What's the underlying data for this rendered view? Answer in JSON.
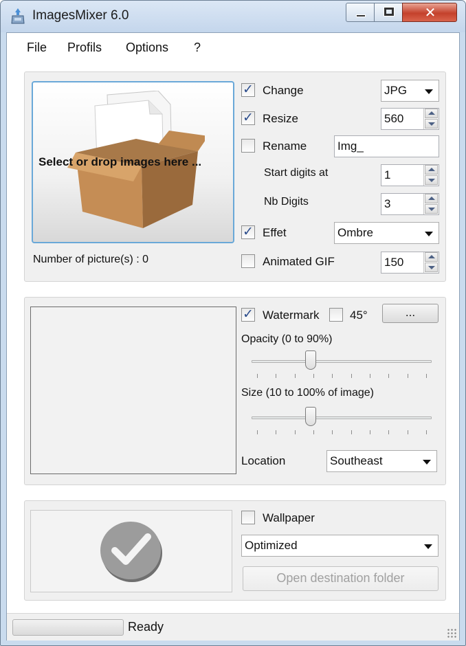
{
  "window": {
    "title": "ImagesMixer 6.0"
  },
  "menu": [
    "File",
    "Profils",
    "Options",
    "?"
  ],
  "images": {
    "drop_text": "Select or drop images here ...",
    "count_text": "Number of picture(s) : 0"
  },
  "options": {
    "change": {
      "label": "Change",
      "checked": true,
      "value": "JPG"
    },
    "resize": {
      "label": "Resize",
      "checked": true,
      "value": "560"
    },
    "rename": {
      "label": "Rename",
      "checked": false,
      "value": "Img_"
    },
    "start_digits": {
      "label": "Start digits at",
      "value": "1"
    },
    "nb_digits": {
      "label": "Nb Digits",
      "value": "3"
    },
    "effet": {
      "label": "Effet",
      "checked": true,
      "value": "Ombre"
    },
    "animated_gif": {
      "label": "Animated GIF",
      "checked": false,
      "value": "150"
    }
  },
  "watermark": {
    "label": "Watermark",
    "checked": true,
    "angle_label": "45°",
    "angle_checked": false,
    "browse_label": "...",
    "opacity_label": "Opacity (0 to 90%)",
    "opacity_value": 0.33,
    "size_label": "Size (10 to 100% of image)",
    "size_value": 0.33,
    "location_label": "Location",
    "location_value": "Southeast"
  },
  "wallpaper": {
    "label": "Wallpaper",
    "checked": false,
    "mode": "Optimized",
    "open_folder_label": "Open destination folder"
  },
  "status": {
    "text": "Ready"
  }
}
